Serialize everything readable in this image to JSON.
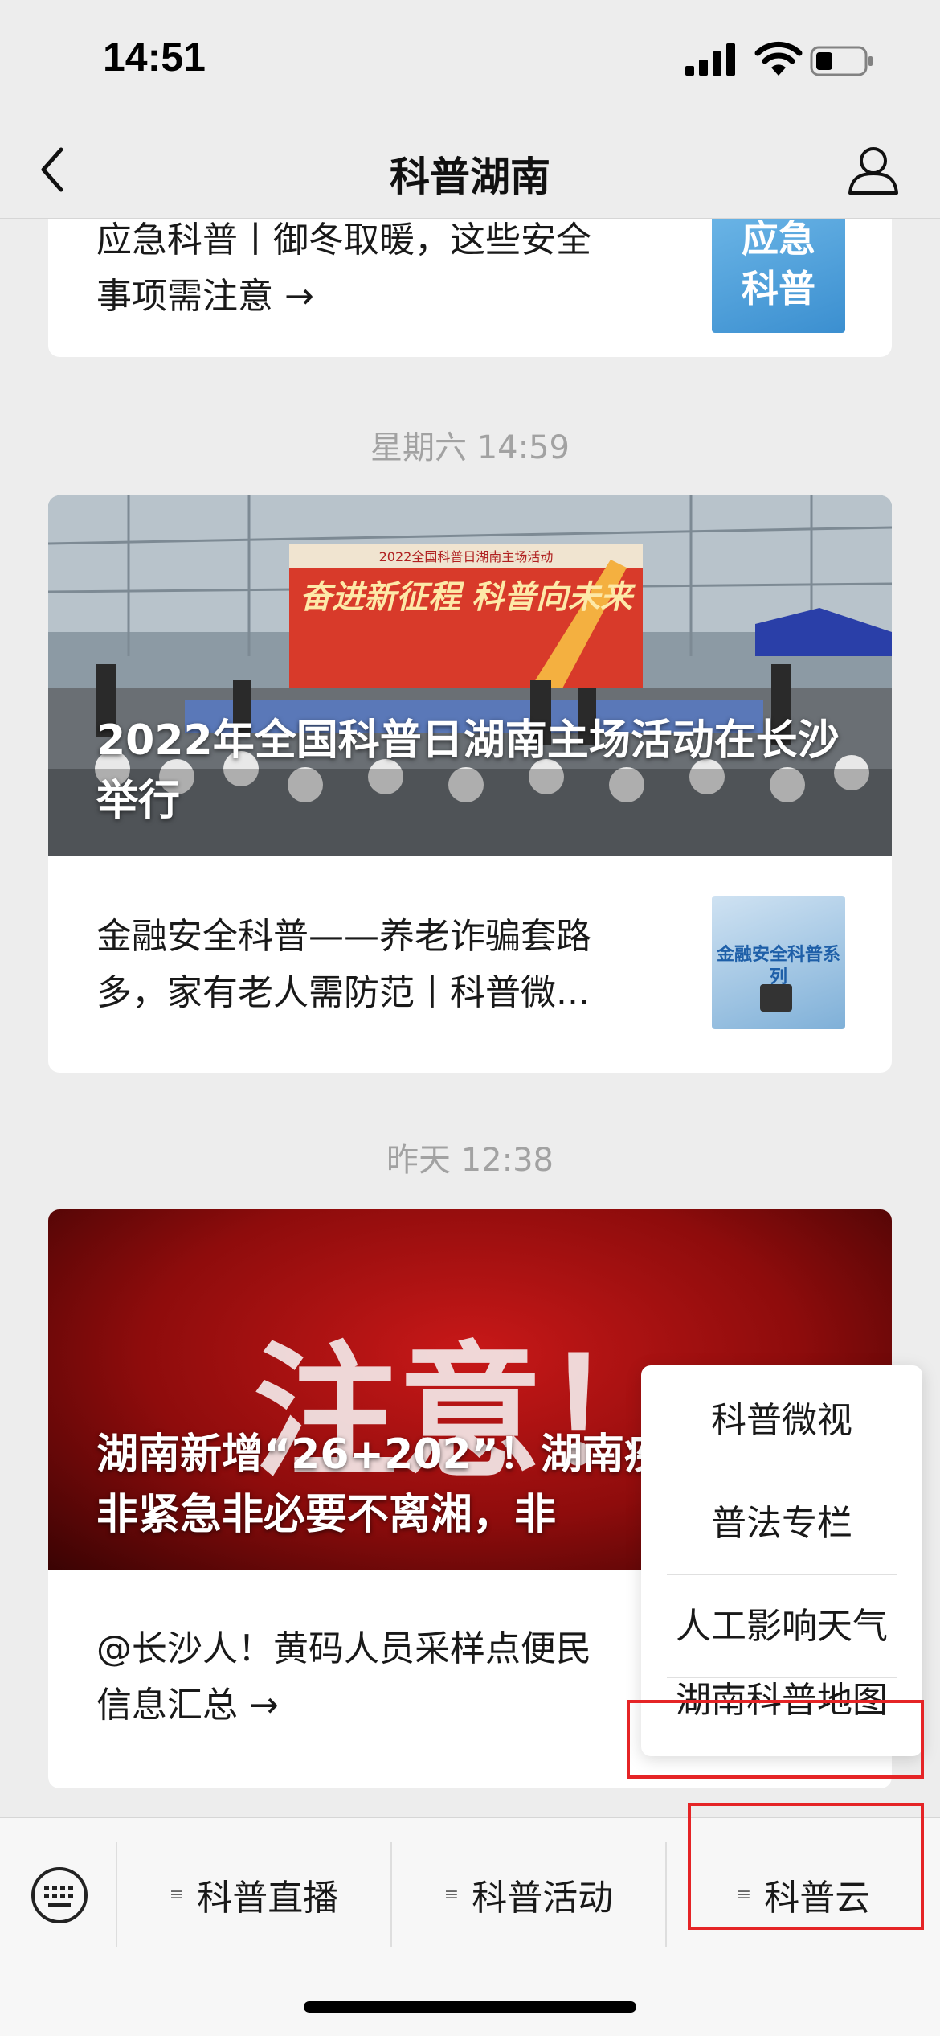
{
  "status_bar": {
    "time": "14:51"
  },
  "nav": {
    "title": "科普湖南",
    "back_icon": "chevron-left-icon",
    "profile_icon": "person-icon"
  },
  "messages": [
    {
      "articles": [
        {
          "title_line1": "应急科普丨御冬取暖，这些安全",
          "title_line2": "事项需注意 →",
          "thumb_text_top": "应急",
          "thumb_text_bottom": "科普"
        }
      ]
    },
    {
      "timestamp": "星期六 14:59",
      "hero": {
        "title": "2022年全国科普日湖南主场活动在长沙举行",
        "banner_text": "奋进新征程 科普向未来",
        "banner_subtitle": "2022全国科普日湖南主场活动"
      },
      "articles": [
        {
          "title": "金融安全科普——养老诈骗套路多，家有老人需防范丨科普微...",
          "thumb_text": "金融安全科普系列"
        }
      ]
    },
    {
      "timestamp": "昨天 12:38",
      "hero": {
        "title": "湖南新增“26+202”！湖南疾控提醒：非紧急非必要不离湘，非",
        "banner_text": "注意！"
      },
      "articles": [
        {
          "title_line1": "@长沙人！黄码人员采样点便民",
          "title_line2": "信息汇总 →"
        }
      ]
    }
  ],
  "popup_menu": {
    "items": [
      "科普微视",
      "普法专栏",
      "人工影响天气",
      "湖南科普地图"
    ],
    "highlighted_item_index": 3
  },
  "bottom_menu": {
    "keyboard_icon": "keyboard-icon",
    "tabs": [
      "科普直播",
      "科普活动",
      "科普云"
    ],
    "highlighted_tab_index": 2
  },
  "colors": {
    "highlight": "#e52426",
    "background": "#ededed"
  }
}
